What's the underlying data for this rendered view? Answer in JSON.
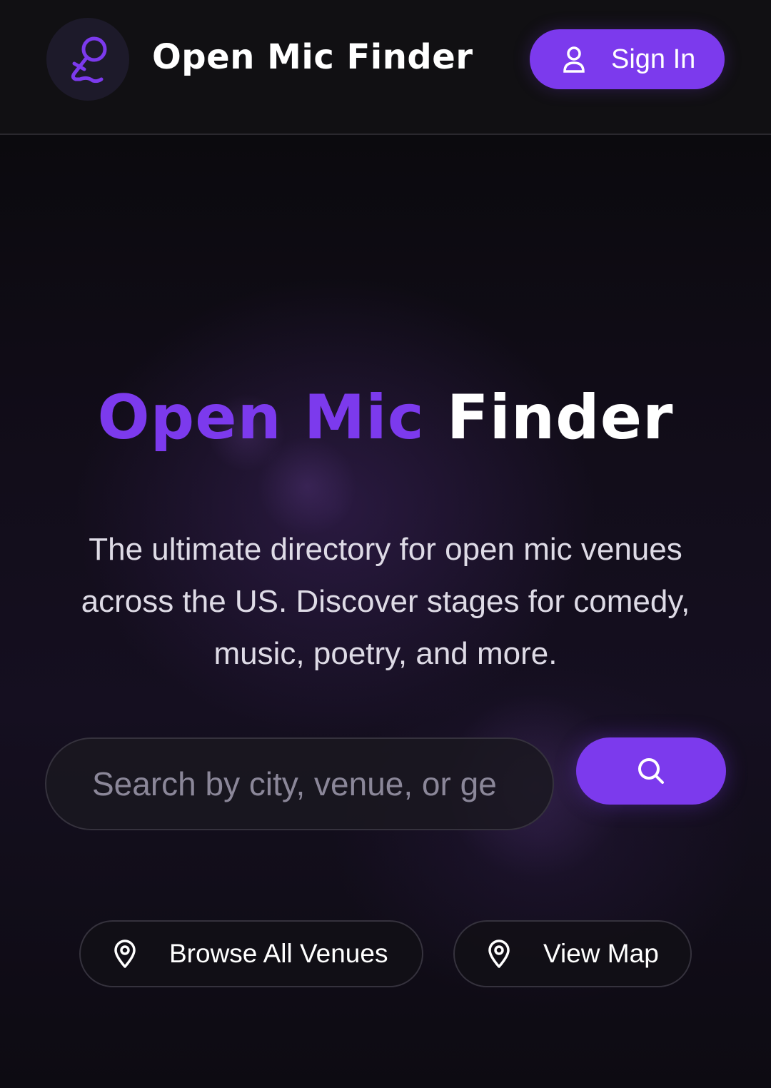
{
  "header": {
    "brand": "Open Mic Finder",
    "signin_label": "Sign In",
    "logo_icon": "microphone-icon",
    "signin_icon": "user-icon"
  },
  "hero": {
    "title_accent": "Open Mic",
    "title_plain": "Finder",
    "subtitle": "The ultimate directory for open mic venues across the US. Discover stages for comedy, music, poetry, and more."
  },
  "search": {
    "placeholder": "Search by city, venue, or ge",
    "value": "",
    "button_icon": "search-icon"
  },
  "actions": {
    "browse_label": "Browse All Venues",
    "map_label": "View Map",
    "icon": "map-pin-icon"
  },
  "colors": {
    "accent": "#7c3aed",
    "background": "#0b0a0e",
    "header_bg": "#111013"
  }
}
